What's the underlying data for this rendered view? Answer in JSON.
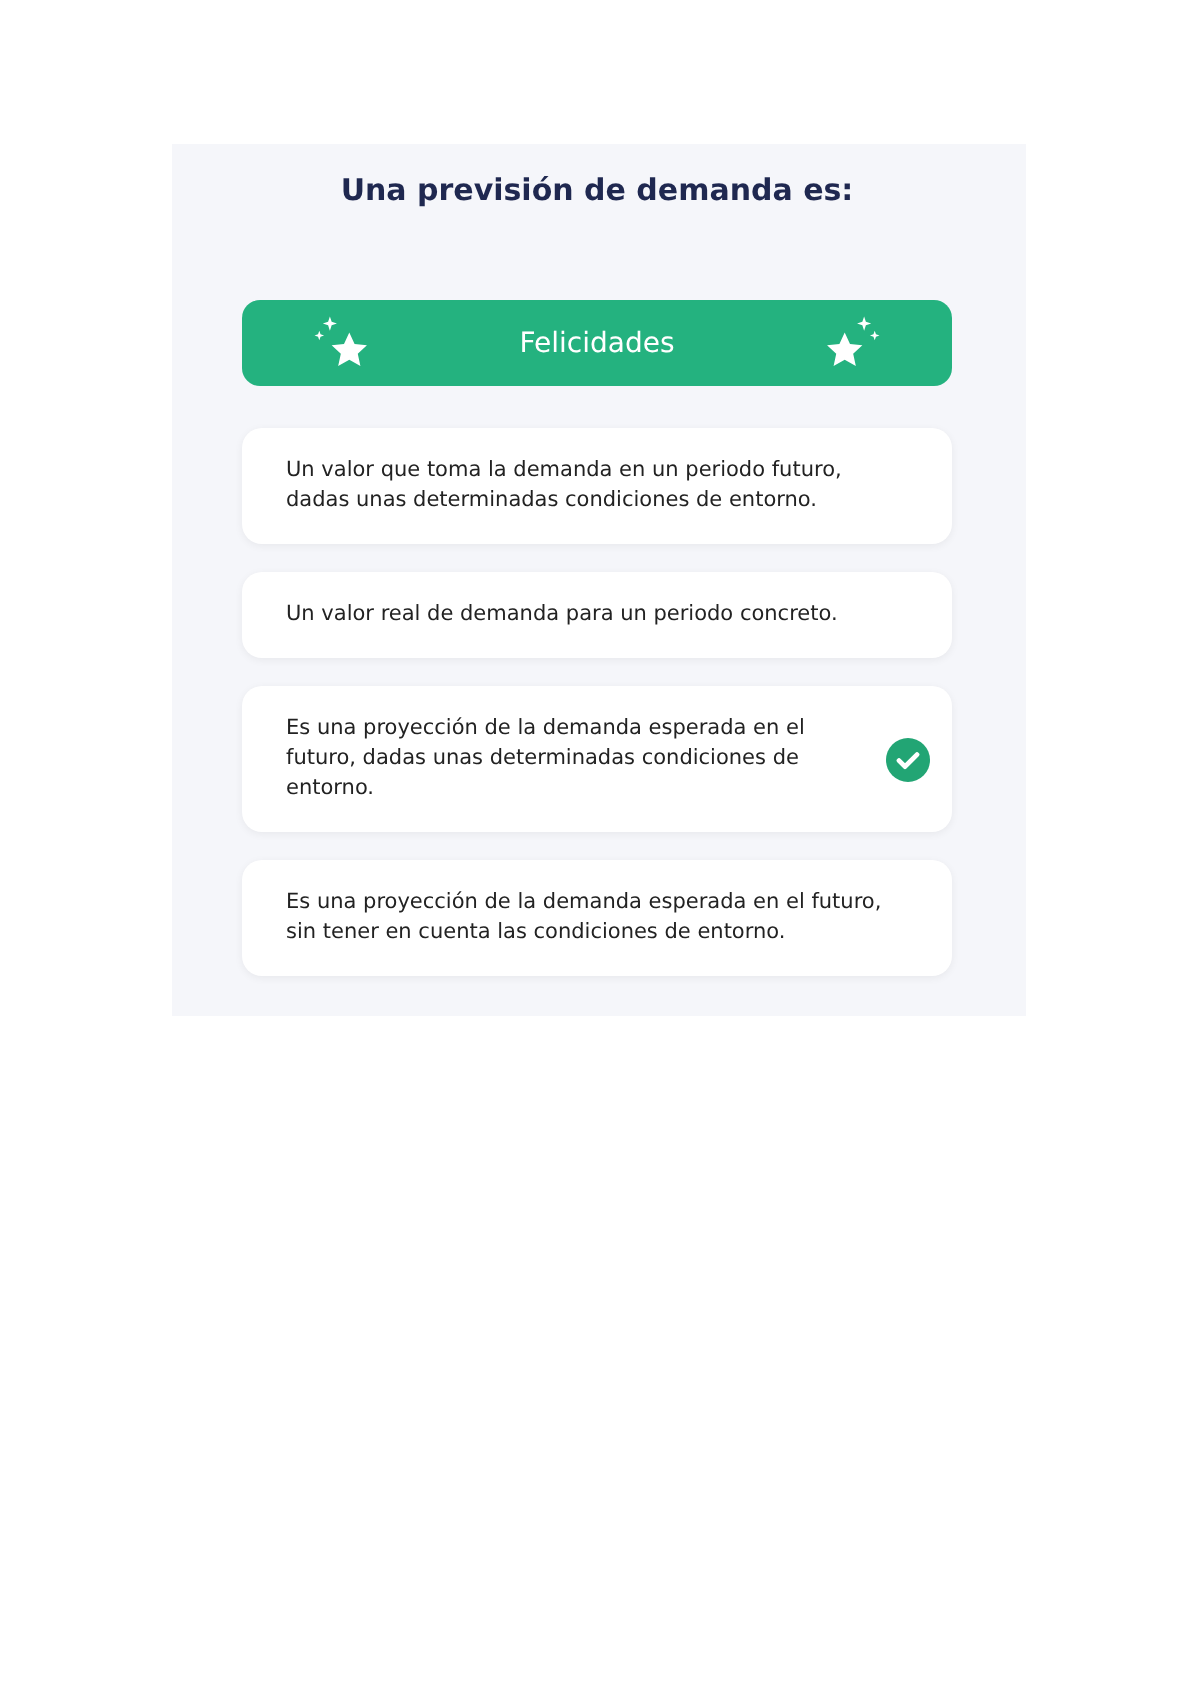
{
  "question": "Una previsión de demanda es:",
  "feedback": {
    "kind": "success",
    "text": "Felicidades"
  },
  "options": [
    {
      "text": "Un valor que toma la demanda en un periodo futuro, dadas unas determinadas condiciones de entorno.",
      "correct": false
    },
    {
      "text": "Un valor real de demanda para un periodo concreto.",
      "correct": false
    },
    {
      "text": "Es una proyección de la demanda esperada en el futuro, dadas unas determinadas condiciones de entorno.",
      "correct": true
    },
    {
      "text": "Es una proyección de la demanda esperada en el futuro, sin tener en cuenta las condiciones de entorno.",
      "correct": false
    }
  ]
}
